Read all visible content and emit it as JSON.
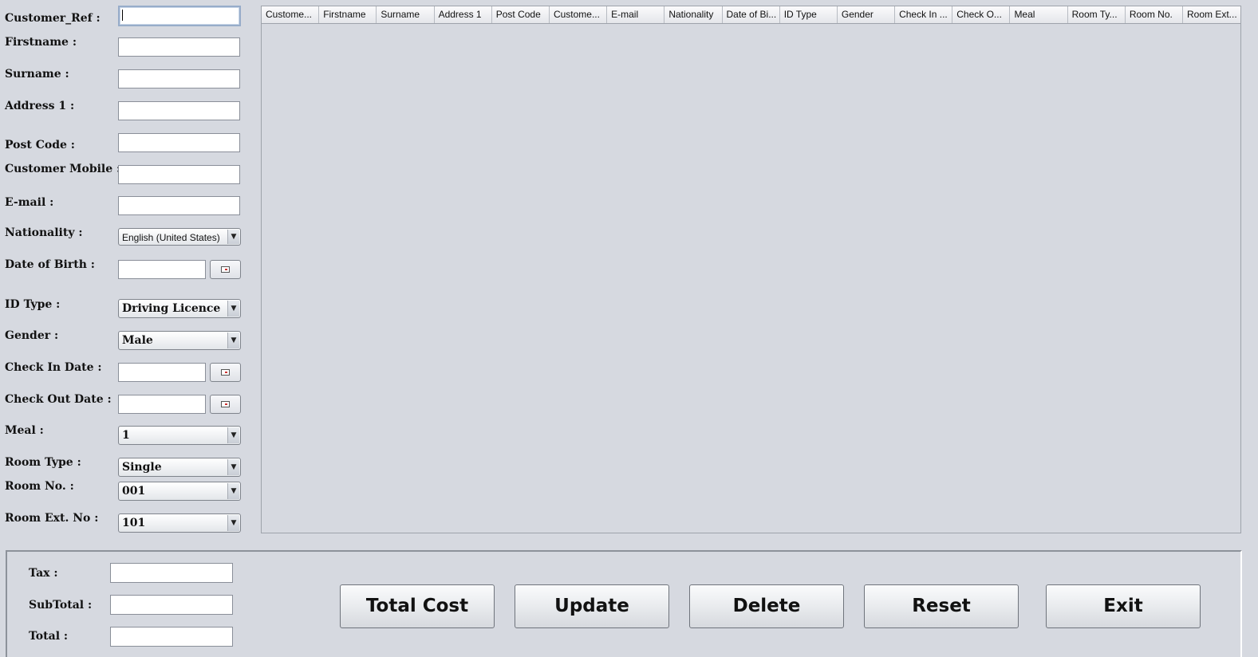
{
  "form": {
    "labels": {
      "customer_ref": "Customer_Ref :",
      "firstname": "Firstname :",
      "surname": "Surname :",
      "address1": "Address 1 :",
      "postcode": "Post Code :",
      "mobile": "Customer Mobile :",
      "email": "E-mail :",
      "nationality": "Nationality :",
      "dob": "Date of Birth :",
      "id_type": "ID Type :",
      "gender": "Gender :",
      "checkin": "Check In Date :",
      "checkout": "Check Out Date :",
      "meal": "Meal :",
      "room_type": "Room Type :",
      "room_no": "Room No. :",
      "room_ext": "Room Ext. No :"
    },
    "values": {
      "nationality": "English (United States)",
      "id_type": "Driving Licence",
      "gender": "Male",
      "meal": "1",
      "room_type": "Single",
      "room_no": "001",
      "room_ext": "101"
    }
  },
  "table": {
    "columns": [
      "Custome...",
      "Firstname",
      "Surname",
      "Address 1",
      "Post Code",
      "Custome...",
      "E-mail",
      "Nationality",
      "Date of Bi...",
      "ID Type",
      "Gender",
      "Check In ...",
      "Check O...",
      "Meal",
      "Room Ty...",
      "Room No.",
      "Room Ext..."
    ],
    "rows": []
  },
  "totals": {
    "tax_label": "Tax :",
    "subtotal_label": "SubTotal :",
    "total_label": "Total :"
  },
  "buttons": {
    "total_cost": "Total Cost",
    "update": "Update",
    "delete": "Delete",
    "reset": "Reset",
    "exit": "Exit"
  },
  "icons": {
    "calendar": "calendar-icon",
    "dropdown": "chevron-down-icon"
  }
}
